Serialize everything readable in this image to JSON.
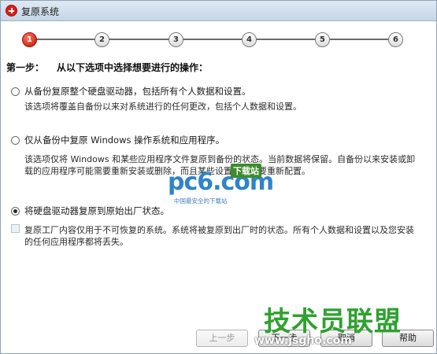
{
  "window": {
    "title": "复原系统"
  },
  "stepper": {
    "steps": [
      "1",
      "2",
      "3",
      "4",
      "5",
      "6"
    ],
    "active_step": 1
  },
  "heading": {
    "step_label": "第一步：",
    "instruction": "从以下选项中选择想要进行的操作："
  },
  "options": [
    {
      "label": "从备份复原整个硬盘驱动器，包括所有个人数据和设置。",
      "description": "该选项将覆盖自备份以来对系统进行的任何更改，包括个人数据和设置。",
      "selected": false
    },
    {
      "label": "仅从备份中复原 Windows 操作系统和应用程序。",
      "description": "该选项仅将 Windows 和某些应用程序文件复原到备份的状态。当前数据将保留。自备份以来安装或卸载的应用程序可能需要重新安装或删除，而且某些设置可能需要重新配置。",
      "selected": false
    },
    {
      "label": "将硬盘驱动器复原到原始出厂状态。",
      "description": "复原工厂内容仅用于不可恢复的系统。系统将被复原到出厂时的状态。所有个人数据和设置以及您安装的任何应用程序都将丢失。",
      "selected": true
    }
  ],
  "buttons": {
    "back": "上一步",
    "next": "下一步",
    "cancel": "取消",
    "help": "帮助"
  },
  "watermarks": {
    "pc6_logo": "pc6.com",
    "pc6_badge": "下载站",
    "pc6_slogan": "中国最安全的下载站",
    "jsgho_name": "技术员联盟",
    "jsgho_url": "www.jsgho.com"
  }
}
